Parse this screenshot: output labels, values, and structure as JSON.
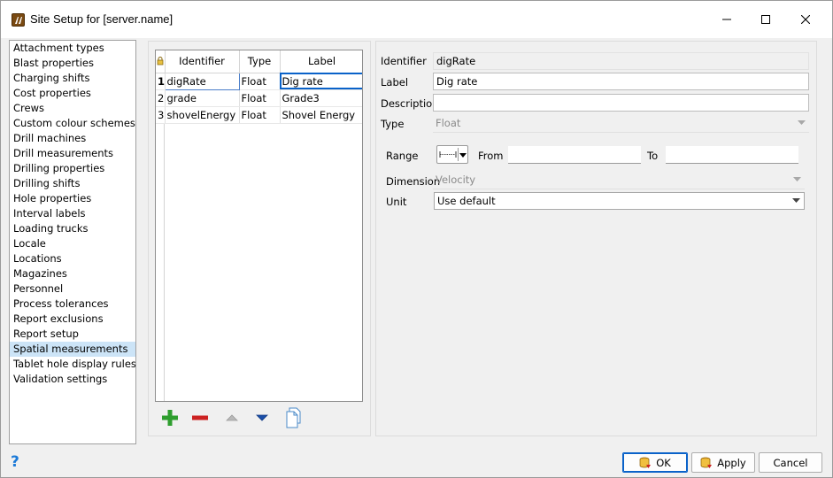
{
  "window": {
    "title": "Site Setup for [server.name]",
    "minimize_icon": "minimize-icon",
    "maximize_icon": "maximize-icon",
    "close_icon": "close-icon"
  },
  "categories": [
    "Attachment types",
    "Blast properties",
    "Charging shifts",
    "Cost properties",
    "Crews",
    "Custom colour schemes",
    "Drill machines",
    "Drill measurements",
    "Drilling properties",
    "Drilling shifts",
    "Hole properties",
    "Interval labels",
    "Loading trucks",
    "Locale",
    "Locations",
    "Magazines",
    "Personnel",
    "Process tolerances",
    "Report exclusions",
    "Report setup",
    "Spatial measurements",
    "Tablet hole display rules",
    "Validation settings"
  ],
  "selected_category": "Spatial measurements",
  "grid": {
    "columns": [
      "Identifier",
      "Type",
      "Label"
    ],
    "rows": [
      {
        "num": "1",
        "identifier": "digRate",
        "type": "Float",
        "label": "Dig rate"
      },
      {
        "num": "2",
        "identifier": "grade",
        "type": "Float",
        "label": "Grade3"
      },
      {
        "num": "3",
        "identifier": "shovelEnergy",
        "type": "Float",
        "label": "Shovel Energy"
      }
    ],
    "lock_icon": "lock-icon"
  },
  "toolbar": {
    "add_icon": "plus-icon",
    "remove_icon": "minus-icon",
    "move_up_icon": "triangle-up-icon",
    "move_down_icon": "triangle-down-icon",
    "copy_icon": "copy-icon"
  },
  "form": {
    "identifier_label": "Identifier",
    "identifier_value": "digRate",
    "label_label": "Label",
    "label_value": "Dig rate",
    "description_label": "Description",
    "description_value": "",
    "type_label": "Type",
    "type_value": "Float",
    "range_label": "Range",
    "from_label": "From",
    "from_value": "",
    "to_label": "To",
    "to_value": "",
    "dimension_label": "Dimension",
    "dimension_value": "Velocity",
    "unit_label": "Unit",
    "unit_value": "Use default"
  },
  "buttons": {
    "ok": "OK",
    "apply": "Apply",
    "cancel": "Cancel"
  },
  "colors": {
    "selection": "#cce4f7",
    "focus": "#0a62c9",
    "add": "#2e9e2e",
    "remove": "#cc2222",
    "help": "#1c7ad8"
  }
}
